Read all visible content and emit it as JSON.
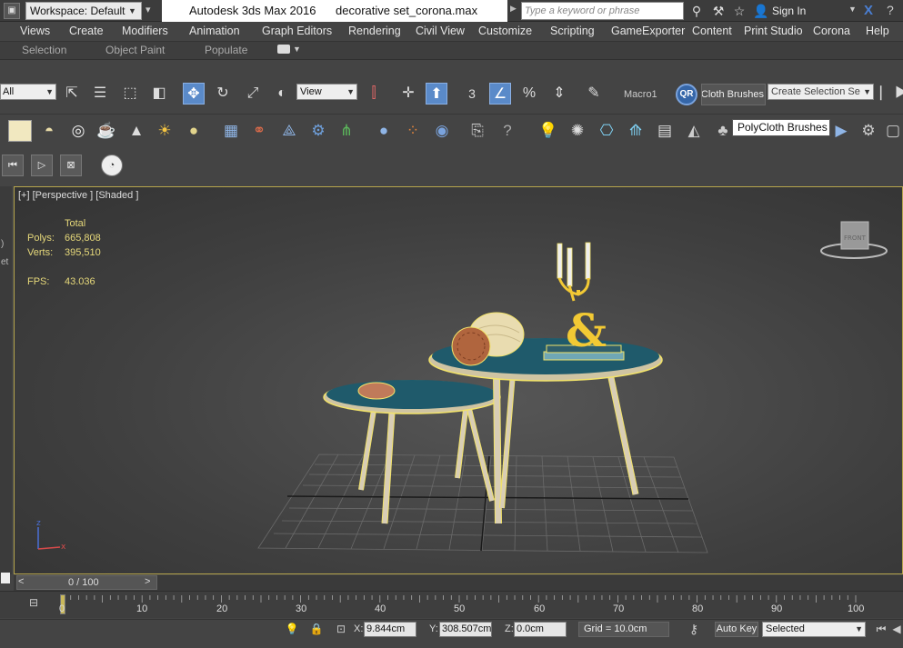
{
  "titlebar": {
    "workspace": "Workspace: Default",
    "app_title": "Autodesk 3ds Max 2016",
    "file_title": "decorative set_corona.max",
    "search_placeholder": "Type a keyword or phrase",
    "sign_in": "Sign In"
  },
  "menu": [
    "Views",
    "Create",
    "Modifiers",
    "Animation",
    "Graph Editors",
    "Rendering",
    "Civil View",
    "Customize",
    "Scripting",
    "GameExporter",
    "Content",
    "Print Studio",
    "Corona",
    "Help"
  ],
  "ribbon_tabs": [
    "Selection",
    "Object Paint",
    "Populate"
  ],
  "toolbar": {
    "filter": "All",
    "ref_coord": "View",
    "snap_label": "3",
    "macro": "Macro1",
    "qr_label": "QR",
    "polycloth": "PolyCloth Brushes",
    "selection_set": "Create Selection Se"
  },
  "tooltip": "PolyCloth Brushes",
  "viewport": {
    "label": "[+] [Perspective ] [Shaded ]",
    "stats": {
      "total_header": "Total",
      "polys_label": "Polys:",
      "polys": "665,808",
      "verts_label": "Verts:",
      "verts": "395,510",
      "fps_label": "FPS:",
      "fps": "43.036"
    },
    "viewcube_label": "FRONT"
  },
  "timeslider": {
    "label": "0 / 100",
    "prev": "<",
    "next": ">"
  },
  "trackbar": {
    "frames": [
      "0",
      "10",
      "20",
      "30",
      "40",
      "50",
      "60",
      "70",
      "80",
      "90",
      "100"
    ]
  },
  "status": {
    "x_label": "X:",
    "x": "9.844cm",
    "y_label": "Y:",
    "y": "308.507cm",
    "z_label": "Z:",
    "z": "0.0cm",
    "grid": "Grid = 10.0cm",
    "auto_key": "Auto Key",
    "key_mode": "Selected"
  },
  "colors": {
    "accent": "#5a8ac9",
    "stats_text": "#e6d87a",
    "viewport_border": "#b6a54c",
    "selection_outline": "#f2e36a"
  }
}
